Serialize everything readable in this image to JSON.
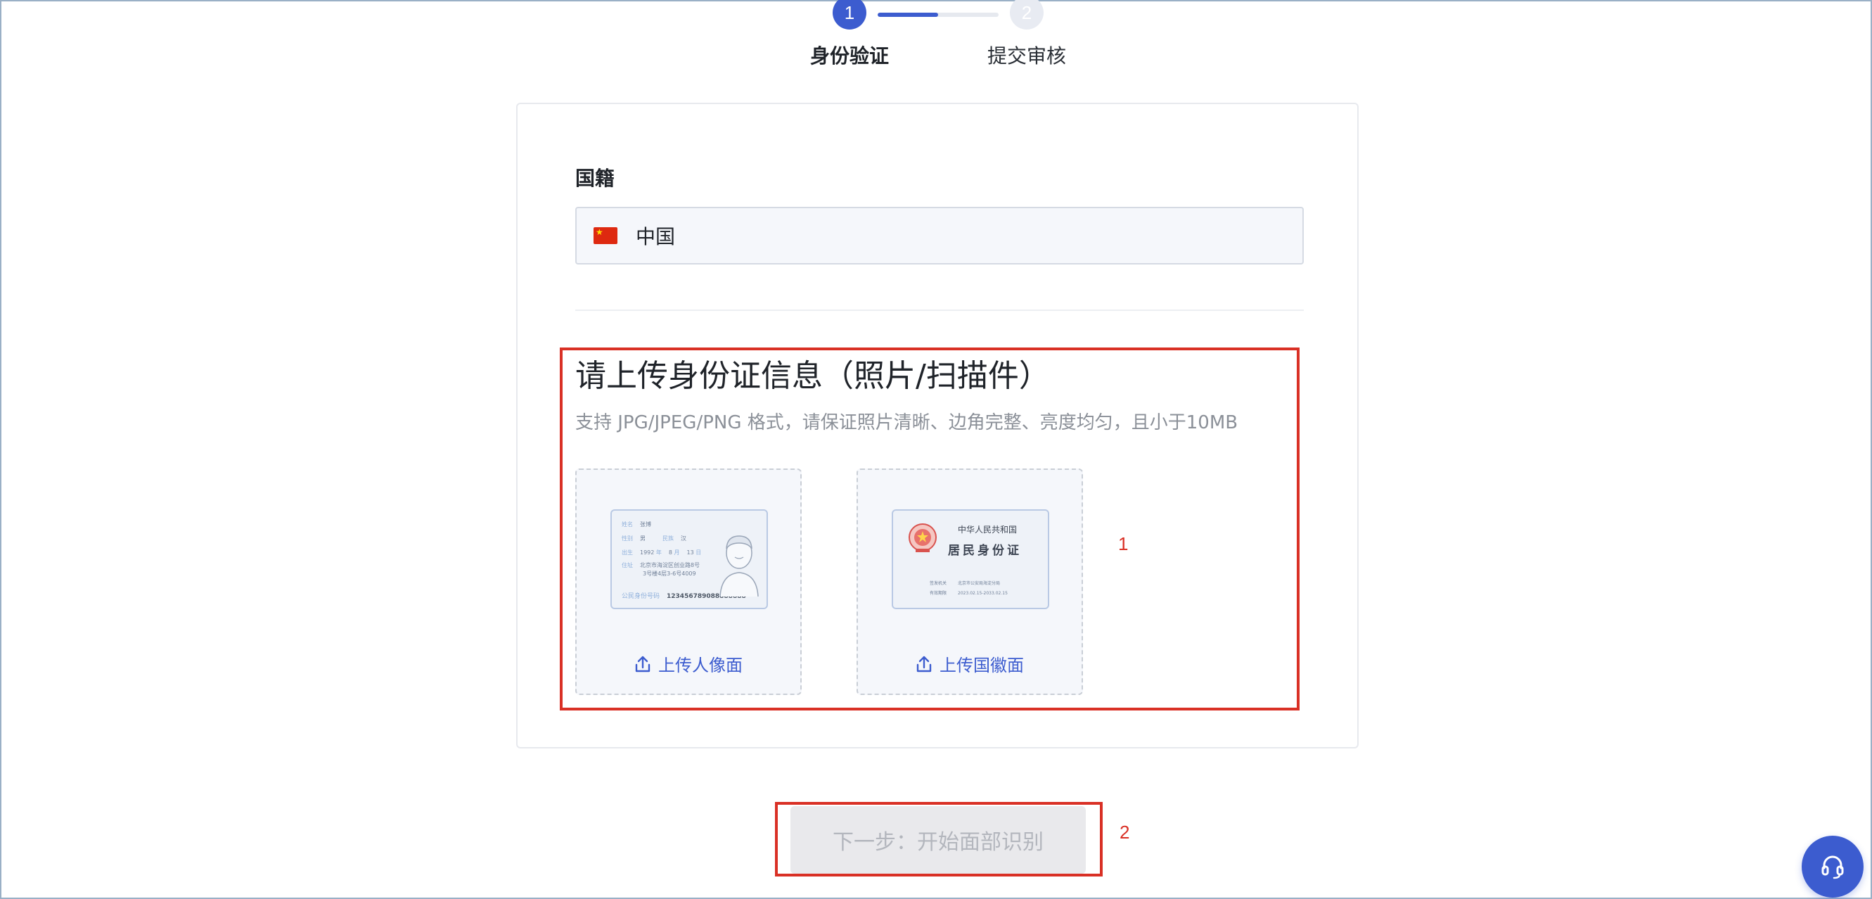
{
  "stepper": {
    "steps": [
      {
        "number": "1",
        "label": "身份验证"
      },
      {
        "number": "2",
        "label": "提交审核"
      }
    ],
    "progress": 0.5
  },
  "nationality": {
    "label": "国籍",
    "value": "中国",
    "flag": "china-flag-icon"
  },
  "upload": {
    "title": "请上传身份证信息（照片/扫描件）",
    "hint": "支持 JPG/JPEG/PNG 格式，请保证照片清晰、边角完整、亮度均匀，且小于10MB",
    "front": {
      "action_label": "上传人像面",
      "sample": {
        "name_key": "姓名",
        "name_value": "张博",
        "gender_key": "性别",
        "gender_value": "男",
        "ethnicity_key": "民族",
        "ethnicity_value": "汉",
        "birth_key": "出生",
        "birth_year": "1992",
        "birth_year_unit": "年",
        "birth_month": "8",
        "birth_month_unit": "月",
        "birth_day": "13",
        "birth_day_unit": "日",
        "address_key": "住址",
        "address_line1": "北京市海淀区创业路8号",
        "address_line2": "3号楼4层3-6号4009",
        "id_key": "公民身份号码",
        "id_value": "123456789088888888"
      }
    },
    "back": {
      "action_label": "上传国徽面",
      "sample": {
        "title1": "中华人民共和国",
        "title2": "居民身份证",
        "authority_key": "签发机关",
        "authority_value": "北京市公安局海淀分局",
        "validity_key": "有效期限",
        "validity_value": "2023.02.15-2033.02.15"
      }
    }
  },
  "annotations": [
    "1",
    "2"
  ],
  "next_button": {
    "label": "下一步：开始面部识别"
  },
  "colors": {
    "primary": "#3c5ccf",
    "annotation": "#d93025",
    "disabled_bg": "#e9e9ec",
    "disabled_text": "#b3b6bd"
  }
}
